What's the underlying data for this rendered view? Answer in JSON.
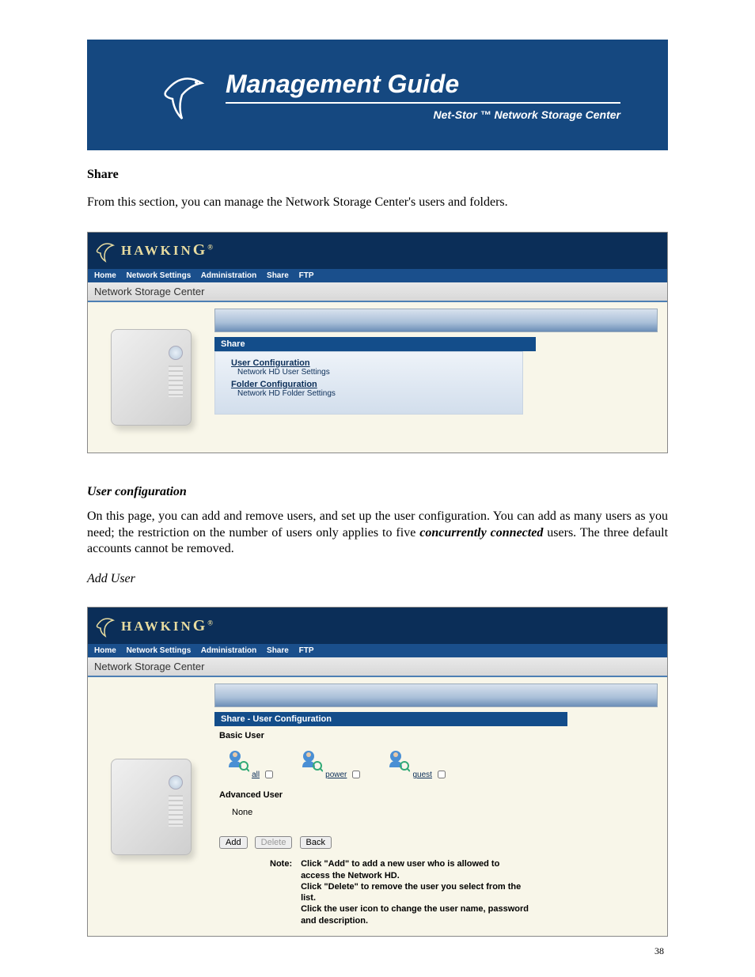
{
  "banner": {
    "title": "Management Guide",
    "subtitle": "Net-Stor ™ Network Storage Center"
  },
  "section1": {
    "heading": "Share",
    "intro": "From this section, you can manage the Network Storage Center's users and folders."
  },
  "app": {
    "brand_prefix": "HAWKIN",
    "brand_suffix": "G",
    "brand_reg": "®",
    "nav": {
      "home": "Home",
      "network": "Network Settings",
      "admin": "Administration",
      "share": "Share",
      "ftp": "FTP"
    },
    "title": "Network Storage Center"
  },
  "panel1": {
    "title": "Share",
    "link1": "User Configuration",
    "desc1": "Network HD User Settings",
    "link2": "Folder Configuration",
    "desc2": "Network HD Folder Settings"
  },
  "section2": {
    "heading": "User configuration",
    "p1a": "On this page, you can add and remove users, and set up the user configuration. You can add as many users as you need; the restriction on the number of users only applies to five ",
    "p1b": "concurrently connected",
    "p1c": " users.  The three default accounts cannot be removed.",
    "sub": "Add User"
  },
  "panel2": {
    "title": "Share - User Configuration",
    "basic_label": "Basic User",
    "users": {
      "u1": "all",
      "u2": "power",
      "u3": "guest"
    },
    "adv_label": "Advanced User",
    "adv_none": "None",
    "buttons": {
      "add": "Add",
      "delete": "Delete",
      "back": "Back"
    },
    "note_label": "Note:",
    "note_text": "Click \"Add\" to add a new user who is allowed to access the Network HD.\nClick \"Delete\" to remove the user you select from the list.\nClick the user icon to change the user name, password and description."
  },
  "page_number": "38"
}
